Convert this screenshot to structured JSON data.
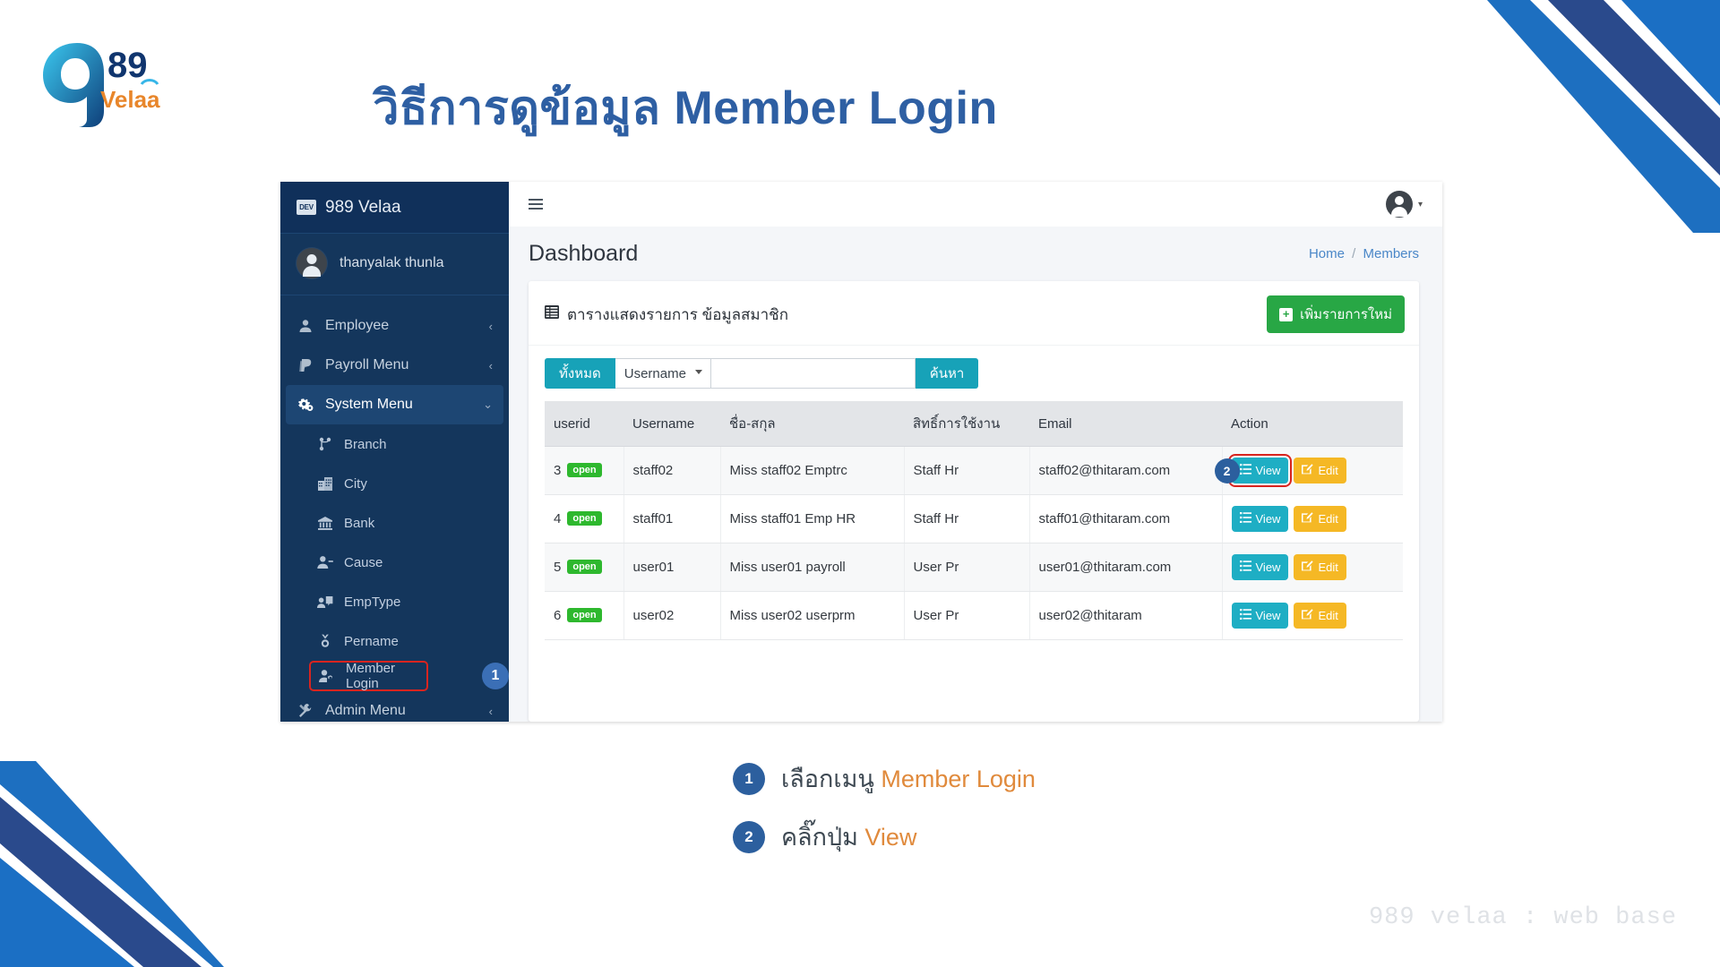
{
  "slide": {
    "title": "วิธีการดูข้อมูล Member Login",
    "footer_note": "989 velaa : web base",
    "title_color": "#2e5fa3"
  },
  "logo": {
    "nine": "9",
    "eightynine": "89",
    "word": "Velaa"
  },
  "app": {
    "sidebar": {
      "brand_badge": "DEV",
      "brand": "989 Velaa",
      "user": "thanyalak thunla",
      "items": [
        {
          "label": "Employee",
          "icon": "user-icon",
          "caret": "‹",
          "active": false
        },
        {
          "label": "Payroll Menu",
          "icon": "paypal-icon",
          "caret": "‹",
          "active": false
        },
        {
          "label": "System Menu",
          "icon": "gears-icon",
          "caret": "⌄",
          "active": true
        }
      ],
      "sub_items": [
        {
          "label": "Branch",
          "icon": "branch-icon"
        },
        {
          "label": "City",
          "icon": "city-icon"
        },
        {
          "label": "Bank",
          "icon": "bank-icon"
        },
        {
          "label": "Cause",
          "icon": "user-minus-icon"
        },
        {
          "label": "EmpType",
          "icon": "emptype-icon"
        },
        {
          "label": "Pername",
          "icon": "pername-icon"
        },
        {
          "label": "Member Login",
          "icon": "user-gear-icon",
          "highlight": true,
          "badge": "1"
        }
      ],
      "admin_item": {
        "label": "Admin Menu",
        "icon": "tools-icon",
        "caret": "‹"
      }
    },
    "topbar": {
      "hamburger": "hamburger-icon",
      "user_caret": "▾"
    },
    "page": {
      "title": "Dashboard",
      "breadcrumb": {
        "home": "Home",
        "sep": "/",
        "current": "Members"
      }
    },
    "card": {
      "title": "ตารางแสดงรายการ ข้อมูลสมาชิก",
      "title_icon": "table-icon",
      "add_button": "เพิ่มรายการใหม่",
      "filter": {
        "all_button": "ทั้งหมด",
        "select_value": "Username",
        "select_options": [
          "Username"
        ],
        "search_value": "",
        "search_placeholder": "",
        "search_button": "ค้นหา"
      },
      "table": {
        "columns": [
          "userid",
          "Username",
          "ชื่อ-สกุล",
          "สิทธิ์การใช้งาน",
          "Email",
          "Action"
        ],
        "rows": [
          {
            "userid": "3",
            "status": "open",
            "username": "staff02",
            "fullname": "Miss staff02 Emptrc",
            "role": "Staff Hr",
            "email": "staff02@thitaram.com",
            "view": "View",
            "edit": "Edit",
            "step_badge": "2",
            "view_highlight": true
          },
          {
            "userid": "4",
            "status": "open",
            "username": "staff01",
            "fullname": "Miss staff01 Emp HR",
            "role": "Staff Hr",
            "email": "staff01@thitaram.com",
            "view": "View",
            "edit": "Edit",
            "step_badge": "",
            "view_highlight": false
          },
          {
            "userid": "5",
            "status": "open",
            "username": "user01",
            "fullname": "Miss user01 payroll",
            "role": "User Pr",
            "email": "user01@thitaram.com",
            "view": "View",
            "edit": "Edit",
            "step_badge": "",
            "view_highlight": false
          },
          {
            "userid": "6",
            "status": "open",
            "username": "user02",
            "fullname": "Miss user02 userprm",
            "role": "User Pr",
            "email": "user02@thitaram",
            "view": "View",
            "edit": "Edit",
            "step_badge": "",
            "view_highlight": false
          }
        ]
      }
    }
  },
  "steps": [
    {
      "num": "1",
      "text_plain": "เลือกเมนู ",
      "text_hi": "Member Login"
    },
    {
      "num": "2",
      "text_plain": "คลิ๊กปุ่ม ",
      "text_hi": "View"
    }
  ],
  "colors": {
    "title": "#2e5fa3",
    "sidebar": "#14365c",
    "sidebar_active": "#1d4673",
    "teal": "#17a2b8",
    "green": "#28a745",
    "amber": "#f5b825",
    "highlight_red": "#d9241f",
    "badge_blue": "#2c5f9e",
    "orange_accent": "#e08a3c"
  }
}
